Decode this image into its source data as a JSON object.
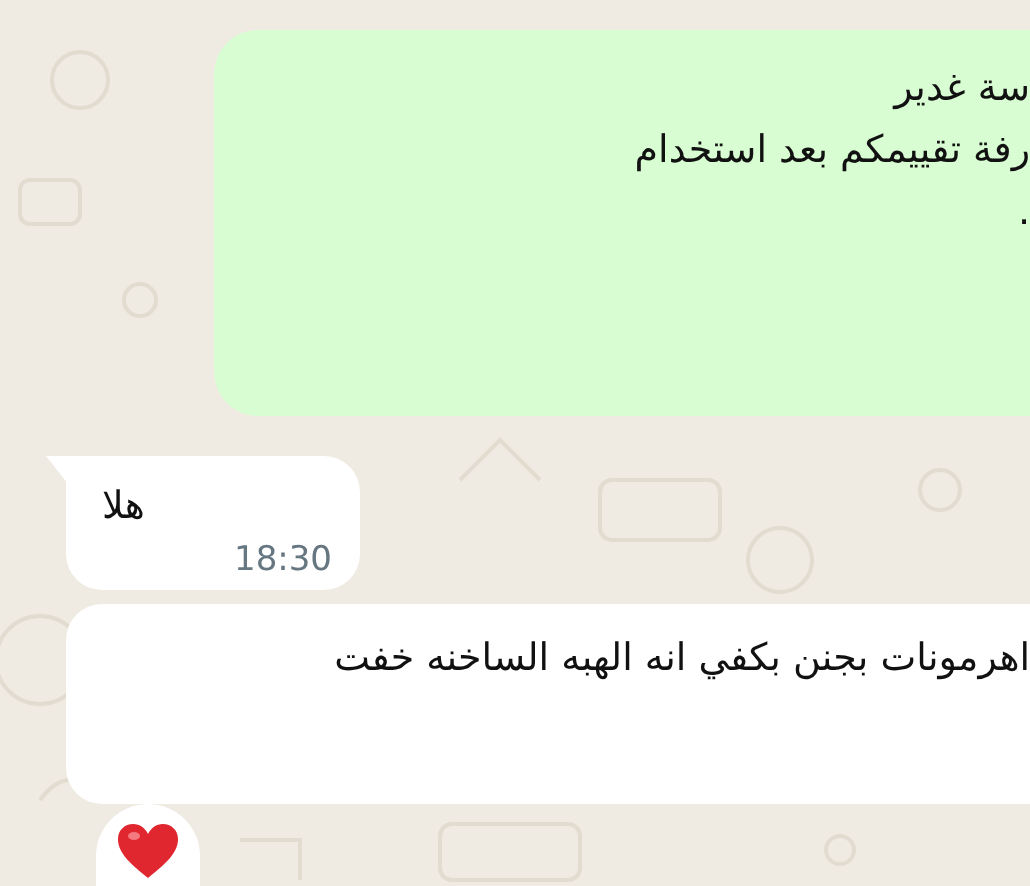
{
  "messages": [
    {
      "kind": "outgoing",
      "lines": [
        "سة غدير",
        "رفة تقييمكم بعد استخدام",
        "."
      ],
      "reaction": false
    },
    {
      "kind": "incoming",
      "lines": [
        "هلا"
      ],
      "time": "18:30",
      "tail": true,
      "reaction": false
    },
    {
      "kind": "incoming",
      "lines": [
        "اهرمونات بجنن بكفي انه الهبه الساخنه خفت"
      ],
      "tail": false,
      "reaction": true
    }
  ]
}
